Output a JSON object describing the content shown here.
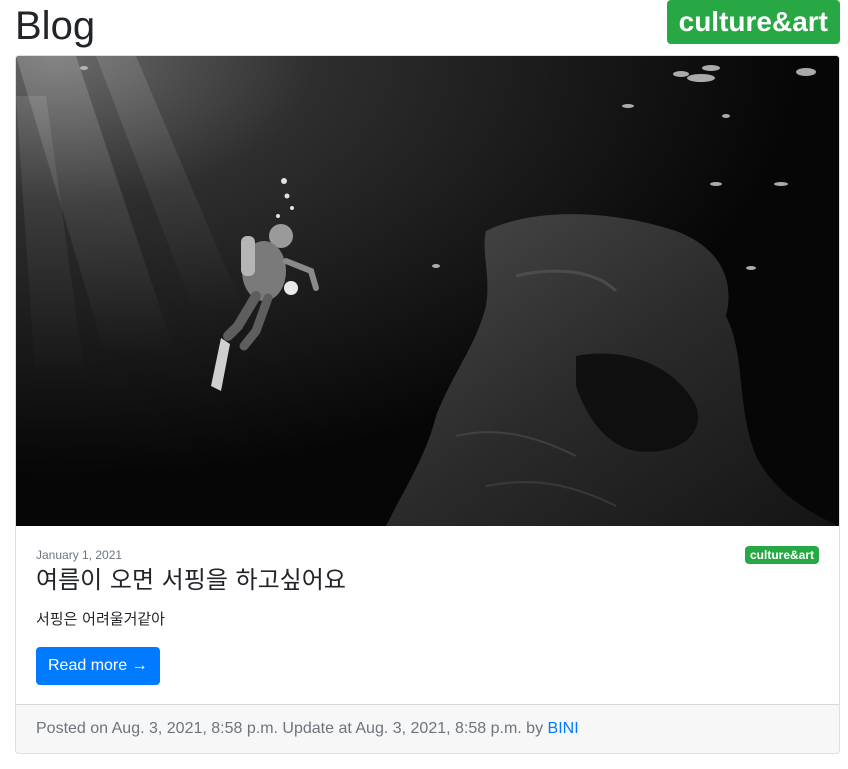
{
  "header": {
    "title": "Blog",
    "category_badge": "culture&art"
  },
  "post": {
    "image_icon": "underwater-diver-photo",
    "date": "January 1, 2021",
    "category": "culture&art",
    "title": "여름이 오면 서핑을 하고싶어요",
    "summary": "서핑은 어려울거같아",
    "read_more_label": "Read more →",
    "footer": {
      "posted_prefix": "Posted on",
      "posted_at": "Aug. 3, 2021, 8:58 p.m.",
      "update_prefix": "Update at",
      "updated_at": "Aug. 3, 2021, 8:58 p.m.",
      "by_prefix": "by",
      "author": "BINI"
    }
  },
  "colors": {
    "badge_green": "#28a745",
    "button_blue": "#007bff",
    "muted_gray": "#6c757d"
  }
}
